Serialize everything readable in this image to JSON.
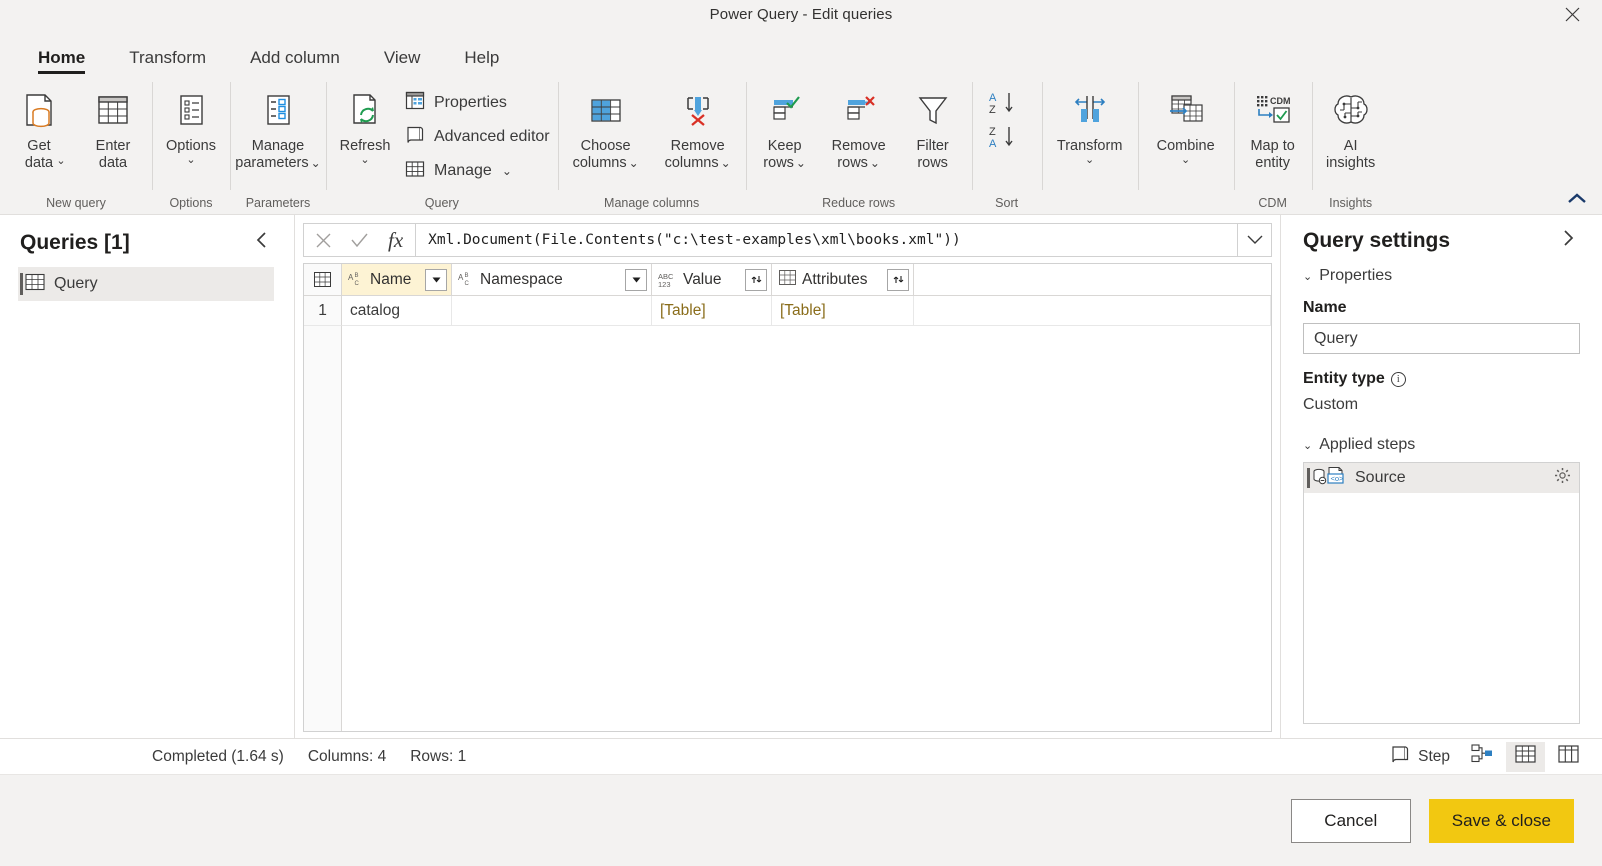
{
  "window": {
    "title": "Power Query - Edit queries",
    "close_glyph": "✕"
  },
  "tabs": [
    {
      "label": "Home",
      "active": true
    },
    {
      "label": "Transform",
      "active": false
    },
    {
      "label": "Add column",
      "active": false
    },
    {
      "label": "View",
      "active": false
    },
    {
      "label": "Help",
      "active": false
    }
  ],
  "ribbon": {
    "collapse_glyph": "⌃",
    "groups": [
      {
        "label": "New query",
        "buttons": [
          {
            "name": "get-data",
            "label": "Get\ndata",
            "caret": true
          },
          {
            "name": "enter-data",
            "label": "Enter\ndata",
            "caret": false
          }
        ]
      },
      {
        "label": "Options",
        "buttons": [
          {
            "name": "options",
            "label": "Options",
            "caret": true
          }
        ]
      },
      {
        "label": "Parameters",
        "buttons": [
          {
            "name": "manage-parameters",
            "label": "Manage\nparameters",
            "caret": true,
            "caret_inline": true
          }
        ]
      },
      {
        "label": "Query",
        "buttons": [
          {
            "name": "refresh",
            "label": "Refresh",
            "caret": true
          }
        ],
        "small_buttons": [
          {
            "name": "properties",
            "label": "Properties",
            "caret": false
          },
          {
            "name": "advanced-editor",
            "label": "Advanced editor",
            "caret": false
          },
          {
            "name": "manage",
            "label": "Manage",
            "caret": true
          }
        ]
      },
      {
        "label": "Manage columns",
        "buttons": [
          {
            "name": "choose-columns",
            "label": "Choose\ncolumns",
            "caret": true,
            "caret_inline": true
          },
          {
            "name": "remove-columns",
            "label": "Remove\ncolumns",
            "caret": true,
            "caret_inline": true
          }
        ]
      },
      {
        "label": "Reduce rows",
        "buttons": [
          {
            "name": "keep-rows",
            "label": "Keep\nrows",
            "caret": true,
            "caret_inline": true
          },
          {
            "name": "remove-rows",
            "label": "Remove\nrows",
            "caret": true,
            "caret_inline": true
          },
          {
            "name": "filter-rows",
            "label": "Filter\nrows",
            "caret": false
          }
        ]
      },
      {
        "label": "Sort",
        "buttons": [
          {
            "name": "sort-ascending",
            "label": "",
            "caret": false
          },
          {
            "name": "sort-descending",
            "label": "",
            "caret": false
          }
        ]
      },
      {
        "label": "",
        "buttons": [
          {
            "name": "transform",
            "label": "Transform",
            "caret": true
          }
        ]
      },
      {
        "label": "",
        "buttons": [
          {
            "name": "combine",
            "label": "Combine",
            "caret": true
          }
        ]
      },
      {
        "label": "CDM",
        "buttons": [
          {
            "name": "map-to-entity",
            "label": "Map to\nentity",
            "caret": false
          }
        ]
      },
      {
        "label": "Insights",
        "buttons": [
          {
            "name": "ai-insights",
            "label": "AI\ninsights",
            "caret": false
          }
        ]
      }
    ]
  },
  "queries_pane": {
    "title": "Queries [1]",
    "collapse_glyph": "‹",
    "items": [
      {
        "label": "Query",
        "selected": true
      }
    ]
  },
  "formula_bar": {
    "cancel_glyph": "✕",
    "accept_glyph": "✓",
    "fx_label": "fx",
    "value": "Xml.Document(File.Contents(\"c:\\test-examples\\xml\\books.xml\"))",
    "expand_glyph": "⌄"
  },
  "grid": {
    "columns": [
      {
        "header": "Name",
        "type_icon": "ABC",
        "type_sub": "text",
        "control": "dropdown",
        "sorted": true
      },
      {
        "header": "Namespace",
        "type_icon": "ABC",
        "type_sub": "text",
        "control": "dropdown",
        "sorted": false
      },
      {
        "header": "Value",
        "type_icon": "ABC",
        "type_sub": "123",
        "control": "expand",
        "sorted": false
      },
      {
        "header": "Attributes",
        "type_icon": "table",
        "type_sub": "",
        "control": "expand",
        "sorted": false
      }
    ],
    "rows": [
      {
        "num": "1",
        "Name": "catalog",
        "Namespace": "",
        "Value": "[Table]",
        "Attributes": "[Table]"
      }
    ]
  },
  "settings_pane": {
    "title": "Query settings",
    "expand_glyph": "›",
    "properties": {
      "section_label": "Properties",
      "name_label": "Name",
      "name_value": "Query",
      "entity_type_label": "Entity type",
      "entity_type_value": "Custom"
    },
    "applied_steps": {
      "section_label": "Applied steps",
      "steps": [
        {
          "label": "Source",
          "selected": true,
          "has_gear": true
        }
      ]
    }
  },
  "statusbar": {
    "status": "Completed (1.64 s)",
    "columns": "Columns: 4",
    "rows": "Rows: 1",
    "step_label": "Step",
    "buttons": [
      {
        "name": "step-view",
        "label": "Step"
      },
      {
        "name": "diagram-view",
        "label": ""
      },
      {
        "name": "data-view",
        "label": "",
        "active": true
      },
      {
        "name": "schema-view",
        "label": ""
      }
    ]
  },
  "footer": {
    "cancel_label": "Cancel",
    "save_label": "Save & close"
  },
  "colors": {
    "accent_yellow": "#f2c811",
    "chrome": "#f3f2f1",
    "sorted_header": "#fdf3d4",
    "selected_row": "#eceae8",
    "link_text": "#8a6d1b"
  }
}
